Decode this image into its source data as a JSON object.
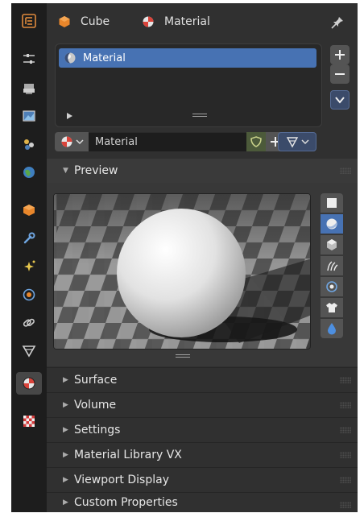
{
  "header": {
    "object_name": "Cube",
    "material_name": "Material"
  },
  "material_slots": {
    "items": [
      {
        "label": "Material"
      }
    ]
  },
  "material_datablock": {
    "name": "Material"
  },
  "panels": [
    {
      "title": "Preview",
      "expanded": true
    },
    {
      "title": "Surface",
      "expanded": false
    },
    {
      "title": "Volume",
      "expanded": false
    },
    {
      "title": "Settings",
      "expanded": false
    },
    {
      "title": "Material Library VX",
      "expanded": false
    },
    {
      "title": "Viewport Display",
      "expanded": false
    },
    {
      "title": "Custom Properties",
      "expanded": false
    }
  ],
  "preview_shapes": [
    {
      "icon": "flat-plane-icon",
      "selected": false
    },
    {
      "icon": "sphere-icon",
      "selected": true
    },
    {
      "icon": "cube-icon",
      "selected": false
    },
    {
      "icon": "hair-icon",
      "selected": false
    },
    {
      "icon": "shaderball-icon",
      "selected": false
    },
    {
      "icon": "cloth-icon",
      "selected": false
    },
    {
      "icon": "fluid-icon",
      "selected": false
    }
  ],
  "property_tabs": [
    {
      "icon": "tool-icon",
      "active": false
    },
    {
      "icon": "render-icon",
      "active": false
    },
    {
      "icon": "output-icon",
      "active": false
    },
    {
      "icon": "view-layer-icon",
      "active": false
    },
    {
      "icon": "scene-icon",
      "active": false
    },
    {
      "icon": "world-icon",
      "active": false
    },
    {
      "icon": "object-icon",
      "active": false
    },
    {
      "icon": "modifier-icon",
      "active": false
    },
    {
      "icon": "particles-icon",
      "active": false
    },
    {
      "icon": "physics-icon",
      "active": false
    },
    {
      "icon": "constraints-icon",
      "active": false
    },
    {
      "icon": "object-data-icon",
      "active": false
    },
    {
      "icon": "material-icon",
      "active": true
    },
    {
      "icon": "texture-icon",
      "active": false
    }
  ],
  "colors": {
    "accent": "#4772b3",
    "background": "#303030",
    "tabbar": "#1d1d1d"
  }
}
